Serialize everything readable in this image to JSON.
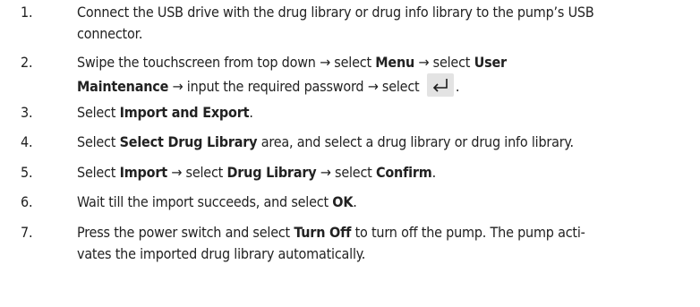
{
  "steps": [
    {
      "num": "1.",
      "line1": "Connect the USB drive with the drug library or drug info library to the pump’s USB",
      "line2": "connector."
    },
    {
      "num": "2.",
      "a": "Swipe the touchscreen from top down → select ",
      "b1": "Menu",
      "c": " → select ",
      "b2": "User",
      "b3": "Maintenance",
      "d": " → input the required password → select ",
      "icon": "enter-return-icon",
      "e": "."
    },
    {
      "num": "3.",
      "a": "Select ",
      "b1": "Import and Export",
      "c": "."
    },
    {
      "num": "4.",
      "a": "Select ",
      "b1": "Select Drug Library",
      "c": " area, and select a drug library or drug info library."
    },
    {
      "num": "5.",
      "a": "Select ",
      "b1": "Import",
      "c": " → select ",
      "b2": "Drug Library",
      "d": " → select ",
      "b3": "Confirm",
      "e": "."
    },
    {
      "num": "6.",
      "a": "Wait till the import succeeds, and select ",
      "b1": "OK",
      "c": "."
    },
    {
      "num": "7.",
      "a": "Press the power switch and select ",
      "b1": "Turn Off",
      "c": " to turn off the pump. The pump acti-",
      "line2": "vates the imported drug library automatically."
    }
  ]
}
